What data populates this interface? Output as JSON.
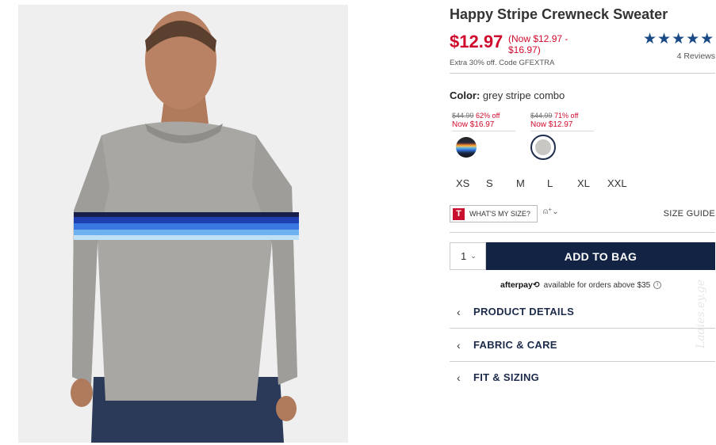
{
  "product": {
    "title": "Happy Stripe Crewneck Sweater",
    "price": "$12.97",
    "price_range": "(Now $12.97 - $16.97)",
    "promo": "Extra 30% off. Code GFEXTRA",
    "rating_stars": "★★★★★",
    "rating_value": 5,
    "reviews": "4 Reviews"
  },
  "color": {
    "label": "Color:",
    "value": "grey stripe combo",
    "swatches": [
      {
        "old_price": "$44.99",
        "discount": "62% off",
        "now": "Now $16.97",
        "name": "navy-stripe-swatch",
        "colors": [
          "#1b2340",
          "#5cb0e6",
          "#f2c14e",
          "#e2732a"
        ]
      },
      {
        "old_price": "$44.99",
        "discount": "71% off",
        "now": "Now $12.97",
        "name": "grey-stripe-swatch",
        "selected": true,
        "colors": [
          "#c9c7c4"
        ]
      }
    ]
  },
  "sizes": [
    "XS",
    "S",
    "M",
    "L",
    "XL",
    "XXL"
  ],
  "fit": {
    "logo": "T",
    "label": "WHAT'S MY SIZE?",
    "extra": "⍝⁺⌄",
    "size_guide": "SIZE GUIDE"
  },
  "cart": {
    "quantity": "1",
    "qty_chevron": "⌄",
    "add_label": "ADD TO BAG"
  },
  "afterpay": {
    "logo": "afterpay⟲",
    "text": "available for orders above $35",
    "info": "i"
  },
  "accordion": [
    {
      "label": "PRODUCT DETAILS",
      "chevron": "‹"
    },
    {
      "label": "FABRIC & CARE",
      "chevron": "‹"
    },
    {
      "label": "FIT & SIZING",
      "chevron": "‹"
    }
  ],
  "watermark": "Ladies.ey.ge",
  "colors": {
    "sale_red": "#d00a2c",
    "navy": "#122344",
    "star_blue": "#1a4a86"
  }
}
